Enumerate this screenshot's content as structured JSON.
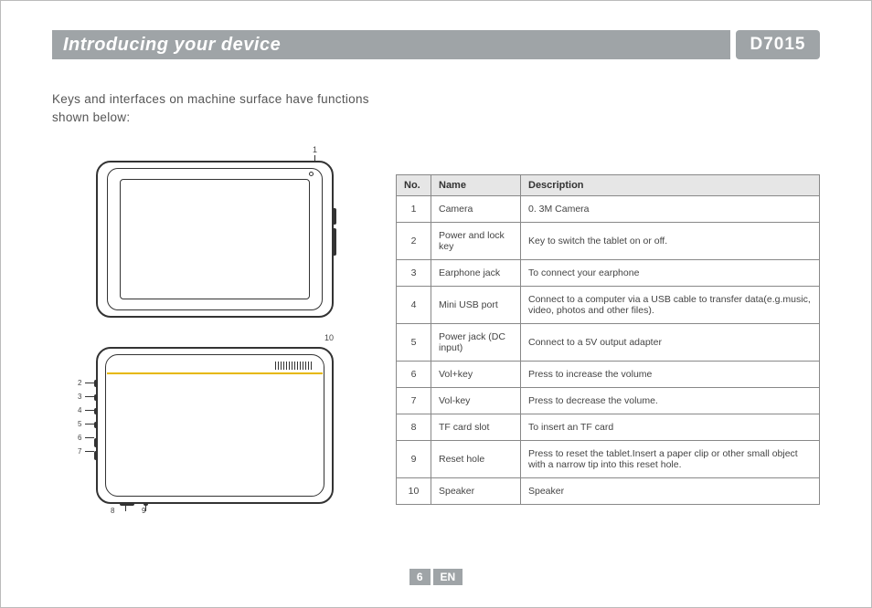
{
  "header": {
    "title": "Introducing your device",
    "badge": "D7015"
  },
  "intro_line1": "Keys and interfaces on machine surface have functions",
  "intro_line2": "shown below:",
  "callouts": {
    "c1": "1",
    "c2": "2",
    "c3": "3",
    "c4": "4",
    "c5": "5",
    "c6": "6",
    "c7": "7",
    "c8": "8",
    "c9": "9",
    "c10": "10"
  },
  "table": {
    "headers": {
      "no": "No.",
      "name": "Name",
      "desc": "Description"
    },
    "rows": [
      {
        "no": "1",
        "name": "Camera",
        "desc": "0. 3M Camera"
      },
      {
        "no": "2",
        "name": "Power and lock key",
        "desc": "Key to switch the tablet on or off."
      },
      {
        "no": "3",
        "name": "Earphone jack",
        "desc": "To connect your earphone"
      },
      {
        "no": "4",
        "name": "Mini USB port",
        "desc": "Connect to a computer via a USB cable  to  transfer  data(e.g.music, video, photos and other files)."
      },
      {
        "no": "5",
        "name": "Power jack (DC input)",
        "desc": "Connect to a 5V output adapter"
      },
      {
        "no": "6",
        "name": "Vol+key",
        "desc": "Press to increase the volume"
      },
      {
        "no": "7",
        "name": "Vol-key",
        "desc": "Press to decrease the volume."
      },
      {
        "no": "8",
        "name": "TF card slot",
        "desc": "To insert an TF card"
      },
      {
        "no": "9",
        "name": "Reset hole",
        "desc": "Press to reset the tablet.Insert a paper clip or other small object with a narrow tip into this reset hole."
      },
      {
        "no": "10",
        "name": "Speaker",
        "desc": "Speaker"
      }
    ]
  },
  "footer": {
    "page": "6",
    "lang": "EN"
  }
}
